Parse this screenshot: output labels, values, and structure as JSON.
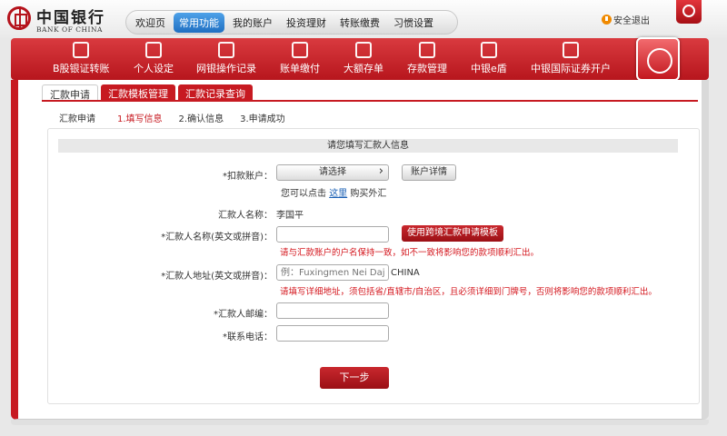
{
  "brand": {
    "name_cn": "中国银行",
    "name_en": "BANK OF CHINA"
  },
  "topnav": {
    "items": [
      {
        "label": "欢迎页",
        "active": false
      },
      {
        "label": "常用功能",
        "active": true
      },
      {
        "label": "我的账户",
        "active": false
      },
      {
        "label": "投资理财",
        "active": false
      },
      {
        "label": "转账缴费",
        "active": false
      },
      {
        "label": "习惯设置",
        "active": false
      }
    ],
    "logout_label": "安全退出"
  },
  "funcbar": {
    "items": [
      {
        "label": "B股银证转账",
        "icon": "chart-icon"
      },
      {
        "label": "个人设定",
        "icon": "gears-icon"
      },
      {
        "label": "网银操作记录",
        "icon": "search-doc-icon"
      },
      {
        "label": "账单缴付",
        "icon": "bill-icon"
      },
      {
        "label": "大额存单",
        "icon": "yuan-note-icon"
      },
      {
        "label": "存款管理",
        "icon": "deposit-icon"
      },
      {
        "label": "中银e盾",
        "icon": "token-icon"
      },
      {
        "label": "中银国际证券开户",
        "icon": "stock-chart-icon"
      }
    ]
  },
  "tabs": [
    {
      "label": "汇款申请",
      "active": true
    },
    {
      "label": "汇款模板管理",
      "active": false
    },
    {
      "label": "汇款记录查询",
      "active": false
    }
  ],
  "steps": {
    "title": "汇款申请",
    "items": [
      "1.填写信息",
      "2.确认信息",
      "3.申请成功"
    ],
    "current": 0
  },
  "form": {
    "title": "请您填写汇款人信息",
    "account_label": "*扣款账户：",
    "account_select": "请选择",
    "account_detail_btn": "账户详情",
    "buy_fx_prefix": "您可以点击",
    "buy_fx_link": "这里",
    "buy_fx_suffix": "购买外汇",
    "remitter_name_label": "汇款人名称：",
    "remitter_name_value": "李国平",
    "name_en_label": "*汇款人名称(英文或拼音)：",
    "name_en_value": "",
    "template_btn": "使用跨境汇款申请模板",
    "name_hint": "请与汇款账户的户名保持一致，如不一致将影响您的款项顺利汇出。",
    "address_label": "*汇款人地址(英文或拼音)：",
    "address_placeholder": "例：Fuxingmen Nei Dajie,B",
    "address_suffix": "CHINA",
    "address_hint": "请填写详细地址，须包括省/直辖市/自治区，且必须详细到门牌号，否则将影响您的款项顺利汇出。",
    "zip_label": "*汇款人邮编：",
    "zip_value": "",
    "phone_label": "*联系电话：",
    "phone_value": "",
    "next_btn": "下一步"
  },
  "colors": {
    "brand_red": "#c71a21",
    "active_blue": "#1f6fc2",
    "hint_red": "#d4161d",
    "link_blue": "#1a5fb4"
  }
}
